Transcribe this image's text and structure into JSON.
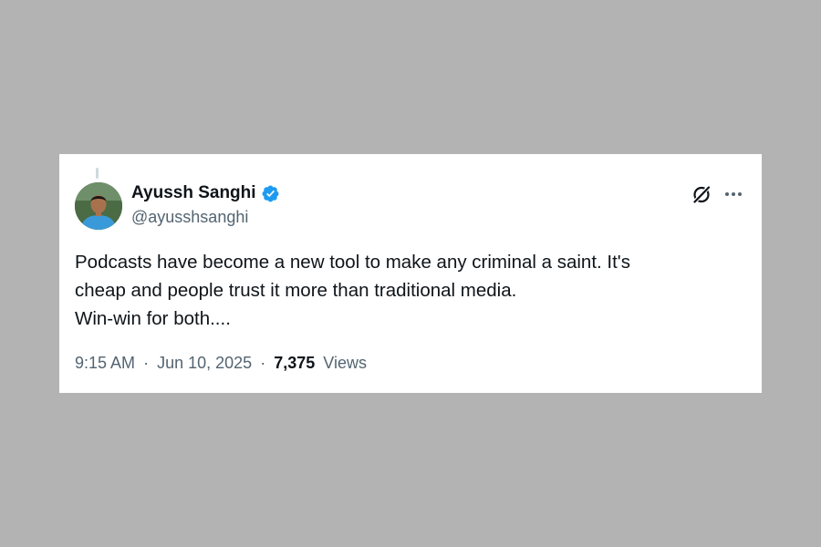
{
  "tweet": {
    "author": {
      "name": "Ayussh Sanghi",
      "handle": "@ayusshsanghi",
      "verified": true,
      "avatar": "profile-photo"
    },
    "text_lines": [
      "Podcasts have become a new tool to make any criminal a saint. It's",
      "cheap and people trust it more than traditional media.",
      "Win-win for both...."
    ],
    "time": "9:15 AM",
    "separator": "·",
    "date": "Jun 10, 2025",
    "views_count": "7,375",
    "views_label": "Views"
  },
  "icons": {
    "verified": "verified-badge-icon",
    "grok": "grok-icon",
    "more": "more-options-icon"
  },
  "colors": {
    "background": "#b3b3b3",
    "card": "#ffffff",
    "text": "#0f1419",
    "secondary": "#536471",
    "verified": "#1d9bf0"
  }
}
